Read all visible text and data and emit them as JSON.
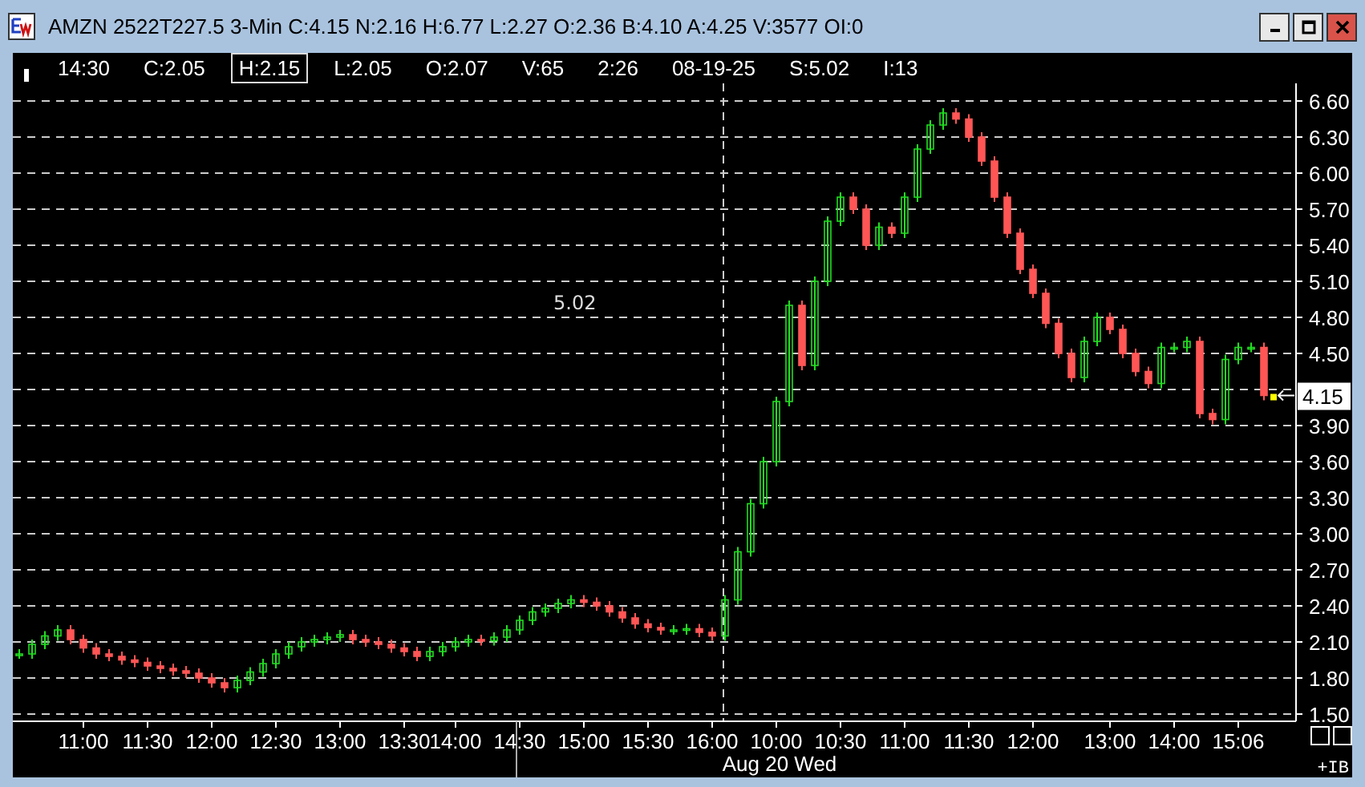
{
  "window": {
    "title": "AMZN 2522T227.5 3-Min C:4.15 N:2.16 H:6.77 L:2.27 O:2.36 B:4.10 A:4.25 V:3577 OI:0"
  },
  "header": {
    "items": [
      {
        "text": "14:30",
        "selected": false
      },
      {
        "text": "C:2.05",
        "selected": false
      },
      {
        "text": "H:2.15",
        "selected": true
      },
      {
        "text": "L:2.05",
        "selected": false
      },
      {
        "text": "O:2.07",
        "selected": false
      },
      {
        "text": "V:65",
        "selected": false
      },
      {
        "text": "2:26",
        "selected": false
      },
      {
        "text": "08-19-25",
        "selected": false
      },
      {
        "text": "S:5.02",
        "selected": false
      },
      {
        "text": "I:13",
        "selected": false
      }
    ]
  },
  "chart": {
    "study_label": "5.02",
    "price_tag": "4.15",
    "date_label": "Aug 20 Wed",
    "corner_label": "+IB",
    "chart_data": {
      "type": "candlestick",
      "categories": [
        null,
        null,
        null,
        null,
        null,
        "11:00",
        null,
        null,
        null,
        null,
        "11:30",
        null,
        null,
        null,
        null,
        "12:00",
        null,
        null,
        null,
        null,
        "12:30",
        null,
        null,
        null,
        null,
        "13:00",
        null,
        null,
        null,
        null,
        "13:30",
        null,
        null,
        null,
        "14:00",
        null,
        null,
        null,
        null,
        "14:30",
        null,
        null,
        null,
        null,
        "15:00",
        null,
        null,
        null,
        null,
        "15:30",
        null,
        null,
        null,
        null,
        "16:00",
        null,
        null,
        null,
        null,
        "10:00",
        null,
        null,
        null,
        null,
        "10:30",
        null,
        null,
        null,
        null,
        "11:00",
        null,
        null,
        null,
        null,
        "11:30",
        null,
        null,
        null,
        null,
        "12:00",
        null,
        null,
        null,
        null,
        null,
        "13:00",
        null,
        null,
        null,
        null,
        "14:00",
        null,
        null,
        null,
        null,
        "15:06",
        null,
        null
      ],
      "ohlc": [
        [
          2.0,
          2.04,
          1.96,
          2.0
        ],
        [
          2.0,
          2.12,
          1.96,
          2.08
        ],
        [
          2.08,
          2.19,
          2.04,
          2.15
        ],
        [
          2.15,
          2.24,
          2.11,
          2.2
        ],
        [
          2.2,
          2.24,
          2.08,
          2.12
        ],
        [
          2.12,
          2.16,
          2.01,
          2.05
        ],
        [
          2.05,
          2.09,
          1.96,
          2.0
        ],
        [
          2.0,
          2.04,
          1.94,
          1.98
        ],
        [
          1.98,
          2.02,
          1.91,
          1.95
        ],
        [
          1.95,
          1.99,
          1.89,
          1.93
        ],
        [
          1.93,
          1.97,
          1.86,
          1.9
        ],
        [
          1.9,
          1.94,
          1.84,
          1.88
        ],
        [
          1.88,
          1.92,
          1.82,
          1.86
        ],
        [
          1.86,
          1.9,
          1.8,
          1.84
        ],
        [
          1.84,
          1.88,
          1.76,
          1.8
        ],
        [
          1.8,
          1.84,
          1.72,
          1.76
        ],
        [
          1.76,
          1.8,
          1.68,
          1.72
        ],
        [
          1.72,
          1.82,
          1.68,
          1.78
        ],
        [
          1.78,
          1.89,
          1.74,
          1.85
        ],
        [
          1.85,
          1.96,
          1.81,
          1.92
        ],
        [
          1.92,
          2.04,
          1.88,
          2.0
        ],
        [
          2.0,
          2.1,
          1.96,
          2.06
        ],
        [
          2.06,
          2.14,
          2.02,
          2.1
        ],
        [
          2.1,
          2.16,
          2.06,
          2.12
        ],
        [
          2.12,
          2.18,
          2.08,
          2.14
        ],
        [
          2.14,
          2.2,
          2.1,
          2.16
        ],
        [
          2.16,
          2.2,
          2.08,
          2.12
        ],
        [
          2.12,
          2.16,
          2.06,
          2.1
        ],
        [
          2.1,
          2.14,
          2.04,
          2.08
        ],
        [
          2.08,
          2.12,
          2.01,
          2.05
        ],
        [
          2.05,
          2.09,
          1.98,
          2.02
        ],
        [
          2.02,
          2.06,
          1.94,
          1.98
        ],
        [
          1.98,
          2.06,
          1.94,
          2.02
        ],
        [
          2.02,
          2.1,
          1.98,
          2.06
        ],
        [
          2.06,
          2.14,
          2.02,
          2.1
        ],
        [
          2.1,
          2.16,
          2.06,
          2.12
        ],
        [
          2.12,
          2.16,
          2.07,
          2.11
        ],
        [
          2.11,
          2.18,
          2.07,
          2.14
        ],
        [
          2.14,
          2.24,
          2.1,
          2.2
        ],
        [
          2.2,
          2.32,
          2.16,
          2.28
        ],
        [
          2.28,
          2.39,
          2.24,
          2.35
        ],
        [
          2.35,
          2.42,
          2.31,
          2.38
        ],
        [
          2.38,
          2.46,
          2.34,
          2.42
        ],
        [
          2.42,
          2.49,
          2.38,
          2.45
        ],
        [
          2.45,
          2.49,
          2.39,
          2.43
        ],
        [
          2.43,
          2.47,
          2.36,
          2.4
        ],
        [
          2.4,
          2.44,
          2.31,
          2.35
        ],
        [
          2.35,
          2.39,
          2.26,
          2.3
        ],
        [
          2.3,
          2.34,
          2.21,
          2.25
        ],
        [
          2.25,
          2.29,
          2.18,
          2.22
        ],
        [
          2.22,
          2.26,
          2.16,
          2.2
        ],
        [
          2.2,
          2.24,
          2.16,
          2.2
        ],
        [
          2.2,
          2.25,
          2.16,
          2.21
        ],
        [
          2.21,
          2.25,
          2.14,
          2.18
        ],
        [
          2.18,
          2.22,
          2.11,
          2.15
        ],
        [
          2.15,
          2.49,
          2.11,
          2.45
        ],
        [
          2.45,
          2.89,
          2.41,
          2.85
        ],
        [
          2.85,
          3.29,
          2.81,
          3.25
        ],
        [
          3.25,
          3.64,
          3.21,
          3.6
        ],
        [
          3.6,
          4.14,
          3.56,
          4.1
        ],
        [
          4.1,
          4.94,
          4.06,
          4.9
        ],
        [
          4.9,
          4.94,
          4.36,
          4.4
        ],
        [
          4.4,
          5.14,
          4.36,
          5.1
        ],
        [
          5.1,
          5.64,
          5.06,
          5.6
        ],
        [
          5.6,
          5.84,
          5.56,
          5.8
        ],
        [
          5.8,
          5.84,
          5.66,
          5.7
        ],
        [
          5.7,
          5.74,
          5.36,
          5.4
        ],
        [
          5.4,
          5.59,
          5.36,
          5.55
        ],
        [
          5.55,
          5.59,
          5.46,
          5.5
        ],
        [
          5.5,
          5.84,
          5.46,
          5.8
        ],
        [
          5.8,
          6.24,
          5.76,
          6.2
        ],
        [
          6.2,
          6.44,
          6.16,
          6.4
        ],
        [
          6.4,
          6.54,
          6.36,
          6.5
        ],
        [
          6.5,
          6.54,
          6.41,
          6.45
        ],
        [
          6.45,
          6.49,
          6.26,
          6.3
        ],
        [
          6.3,
          6.34,
          6.06,
          6.1
        ],
        [
          6.1,
          6.14,
          5.76,
          5.8
        ],
        [
          5.8,
          5.84,
          5.46,
          5.5
        ],
        [
          5.5,
          5.54,
          5.16,
          5.2
        ],
        [
          5.2,
          5.24,
          4.96,
          5.0
        ],
        [
          5.0,
          5.04,
          4.71,
          4.75
        ],
        [
          4.75,
          4.79,
          4.46,
          4.5
        ],
        [
          4.5,
          4.54,
          4.26,
          4.3
        ],
        [
          4.3,
          4.64,
          4.26,
          4.6
        ],
        [
          4.6,
          4.84,
          4.56,
          4.8
        ],
        [
          4.8,
          4.84,
          4.66,
          4.7
        ],
        [
          4.7,
          4.74,
          4.46,
          4.5
        ],
        [
          4.5,
          4.54,
          4.31,
          4.35
        ],
        [
          4.35,
          4.39,
          4.21,
          4.25
        ],
        [
          4.25,
          4.59,
          4.21,
          4.55
        ],
        [
          4.55,
          4.59,
          4.51,
          4.55
        ],
        [
          4.55,
          4.64,
          4.51,
          4.6
        ],
        [
          4.6,
          4.64,
          3.96,
          4.0
        ],
        [
          4.0,
          4.04,
          3.91,
          3.95
        ],
        [
          3.95,
          4.49,
          3.91,
          4.45
        ],
        [
          4.45,
          4.59,
          4.41,
          4.55
        ],
        [
          4.55,
          4.59,
          4.51,
          4.55
        ],
        [
          4.55,
          4.59,
          4.11,
          4.15
        ]
      ],
      "grid": true,
      "ylim": [
        1.44,
        6.7467
      ],
      "yticks": [
        {
          "value": 6.6,
          "label": "6.60"
        },
        {
          "value": 6.3,
          "label": "6.30"
        },
        {
          "value": 6.0,
          "label": "6.00"
        },
        {
          "value": 5.7,
          "label": "5.70"
        },
        {
          "value": 5.4,
          "label": "5.40"
        },
        {
          "value": 5.1,
          "label": "5.10"
        },
        {
          "value": 4.8,
          "label": "4.80"
        },
        {
          "value": 4.5,
          "label": "4.50"
        },
        {
          "value": 3.9,
          "label": "3.90"
        },
        {
          "value": 3.6,
          "label": "3.60"
        },
        {
          "value": 3.3,
          "label": "3.30"
        },
        {
          "value": 3.0,
          "label": "3.00"
        },
        {
          "value": 2.7,
          "label": "2.70"
        },
        {
          "value": 2.4,
          "label": "2.40"
        },
        {
          "value": 2.1,
          "label": "2.10"
        },
        {
          "value": 1.8,
          "label": "1.80"
        },
        {
          "value": 1.5,
          "label": "1.50"
        }
      ]
    }
  }
}
